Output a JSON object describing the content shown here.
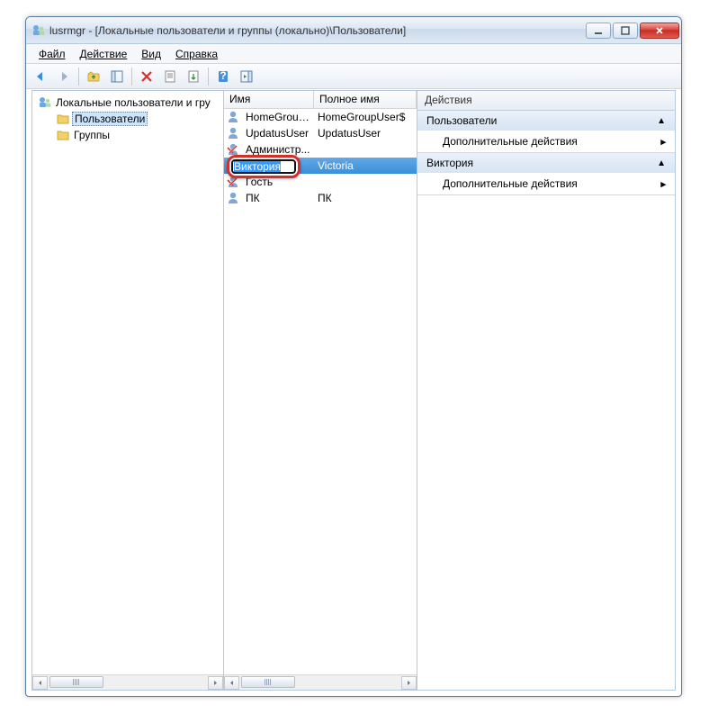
{
  "window": {
    "title": "lusrmgr - [Локальные пользователи и группы (локально)\\Пользователи]"
  },
  "menu": {
    "file": "Файл",
    "action": "Действие",
    "view": "Вид",
    "help": "Справка"
  },
  "tree": {
    "root": "Локальные пользователи и гру",
    "users": "Пользователи",
    "groups": "Группы"
  },
  "list": {
    "col_name": "Имя",
    "col_fullname": "Полное имя",
    "rows": [
      {
        "name": "HomeGroup...",
        "full": "HomeGroupUser$",
        "disabled": false
      },
      {
        "name": "UpdatusUser",
        "full": "UpdatusUser",
        "disabled": false
      },
      {
        "name": "Администр...",
        "full": "",
        "disabled": true
      },
      {
        "name": "Виктория",
        "full": "Victoria",
        "disabled": false,
        "selected": true
      },
      {
        "name": "Гость",
        "full": "",
        "disabled": true
      },
      {
        "name": "ПК",
        "full": "ПК",
        "disabled": false
      }
    ],
    "rename_value": "Виктория"
  },
  "actions": {
    "header": "Действия",
    "section_users": "Пользователи",
    "more_actions": "Дополнительные действия",
    "section_selected": "Виктория"
  },
  "colors": {
    "selection": "#3b8fd9",
    "annotation": "#d4302b"
  }
}
